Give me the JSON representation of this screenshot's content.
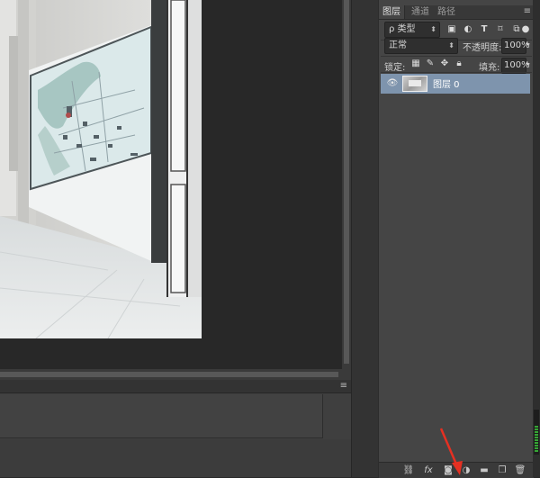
{
  "layers_panel": {
    "tabs": [
      "图层",
      "通道",
      "路径"
    ],
    "panel_menu_icon": "≡",
    "filter": {
      "label": "ρ 类型"
    },
    "blend_mode": "正常",
    "opacity_label": "不透明度:",
    "opacity_value": "100%",
    "lock_label": "锁定:",
    "fill_label": "填充:",
    "fill_value": "100%",
    "layers": [
      {
        "name": "图层 0",
        "selected": true,
        "visible": true
      }
    ]
  },
  "lower_panel": {
    "panel_menu_icon": "≡"
  },
  "colors": {
    "canvas_bg": "#282828",
    "panel_bg": "#454545",
    "selected_layer": "#7e94ad",
    "annotation_arrow": "#e53022",
    "meter_green": "#35a534"
  }
}
